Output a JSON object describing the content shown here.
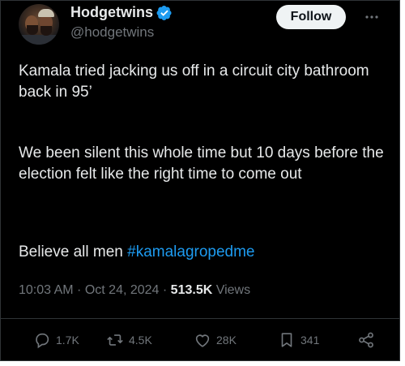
{
  "user": {
    "display_name": "Hodgetwins",
    "handle": "@hodgetwins"
  },
  "follow_label": "Follow",
  "tweet": {
    "paragraphs": [
      "Kamala tried jacking us off in a circuit city bathroom back in 95’",
      "We been silent this whole time but 10 days before the election felt like the right time to come out"
    ],
    "final_text": "Believe all men ",
    "hashtag": "#kamalagropedme"
  },
  "meta": {
    "time": "10:03 AM",
    "separator1": " · ",
    "date": "Oct 24, 2024",
    "separator2": " · ",
    "views_count": "513.5K",
    "views_label": " Views"
  },
  "actions": {
    "replies": "1.7K",
    "reposts": "4.5K",
    "likes": "28K",
    "bookmarks": "341"
  },
  "colors": {
    "background": "#000000",
    "text": "#e7e9ea",
    "muted": "#71767b",
    "link": "#1d9bf0",
    "verified": "#1d9bf0"
  }
}
